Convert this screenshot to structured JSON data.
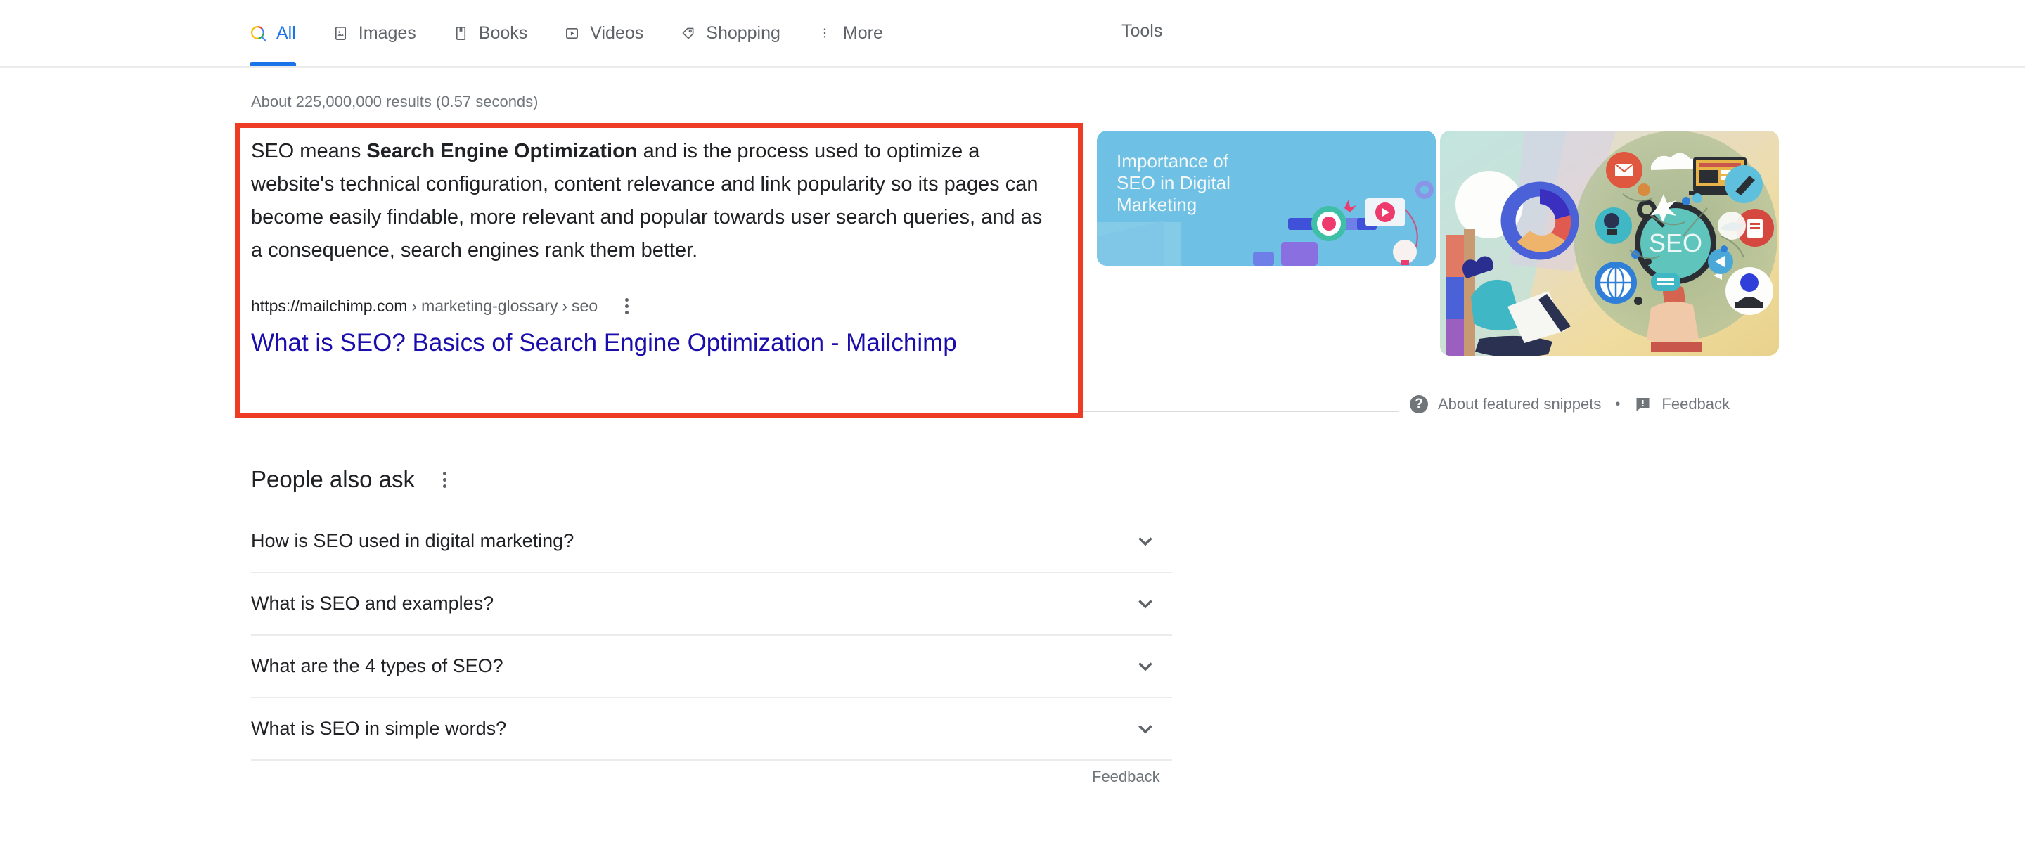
{
  "nav": {
    "tabs": [
      {
        "label": "All",
        "icon": "google-search-icon",
        "active": true
      },
      {
        "label": "Images",
        "icon": "image-icon",
        "active": false
      },
      {
        "label": "Books",
        "icon": "book-icon",
        "active": false
      },
      {
        "label": "Videos",
        "icon": "video-icon",
        "active": false
      },
      {
        "label": "Shopping",
        "icon": "tag-icon",
        "active": false
      },
      {
        "label": "More",
        "icon": "kebab-icon",
        "active": false
      }
    ],
    "tools_label": "Tools"
  },
  "results": {
    "count_text": "About 225,000,000 results (0.57 seconds)"
  },
  "featured_snippet": {
    "text_parts": {
      "before": "SEO means ",
      "bold": "Search Engine Optimization",
      "after": " and is the process used to optimize a website's technical configuration, content relevance and link popularity so its pages can become easily findable, more relevant and popular towards user search queries, and as a consequence, search engines rank them better."
    },
    "url": {
      "domain": "https://mailchimp.com",
      "crumb1": "marketing-glossary",
      "crumb2": "seo",
      "separator": "›"
    },
    "title": "What is SEO? Basics of Search Engine Optimization - Mailchimp",
    "thumbnails": [
      {
        "caption": "Importance of SEO in Digital Marketing",
        "alt": "importance-of-seo-in-digital-marketing-illustration"
      },
      {
        "caption": "",
        "alt": "seo-magnifying-glass-icons-illustration"
      }
    ],
    "footer": {
      "about_label": "About featured snippets",
      "separator": "•",
      "feedback_label": "Feedback"
    }
  },
  "people_also_ask": {
    "title": "People also ask",
    "questions": [
      "How is SEO used in digital marketing?",
      "What is SEO and examples?",
      "What are the 4 types of SEO?",
      "What is SEO in simple words?"
    ],
    "feedback_label": "Feedback"
  },
  "annotation": {
    "color": "#ee3b23"
  },
  "colors": {
    "link_blue": "#1a0dab",
    "tab_active_blue": "#1a73e8",
    "text_gray": "#70757a",
    "text_primary": "#202124",
    "divider": "#ebebeb"
  }
}
